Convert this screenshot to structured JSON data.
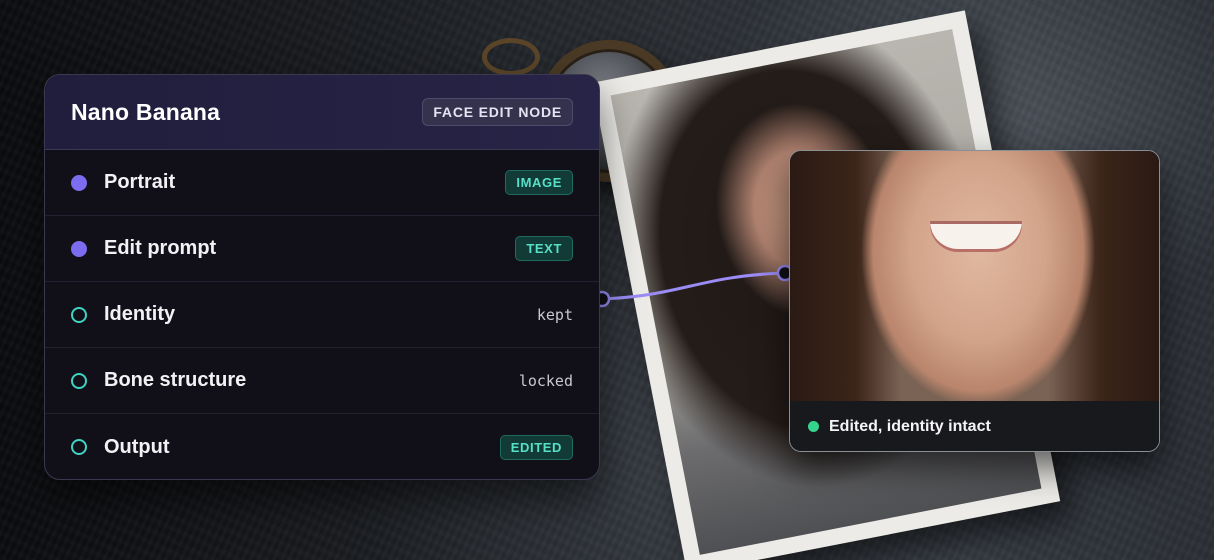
{
  "node": {
    "title": "Nano Banana",
    "tag": "FACE EDIT NODE",
    "rows": [
      {
        "label": "Portrait",
        "port": "input",
        "value": "IMAGE",
        "value_style": "pill"
      },
      {
        "label": "Edit prompt",
        "port": "input",
        "value": "TEXT",
        "value_style": "pill"
      },
      {
        "label": "Identity",
        "port": "constraint",
        "value": "kept",
        "value_style": "mono"
      },
      {
        "label": "Bone structure",
        "port": "constraint",
        "value": "locked",
        "value_style": "mono"
      },
      {
        "label": "Output",
        "port": "output",
        "value": "EDITED",
        "value_style": "pill"
      }
    ]
  },
  "result": {
    "status": "Edited, identity intact"
  },
  "colors": {
    "input_port": "#7b6cf0",
    "constraint_port": "#3fd3c2",
    "pill_text": "#56e0c8",
    "wire": "#9b8cf5",
    "status_ok": "#35d48e"
  },
  "icons": {
    "filled_port": "filled-circle-icon",
    "outline_port": "outline-circle-icon",
    "status": "status-dot-icon"
  }
}
